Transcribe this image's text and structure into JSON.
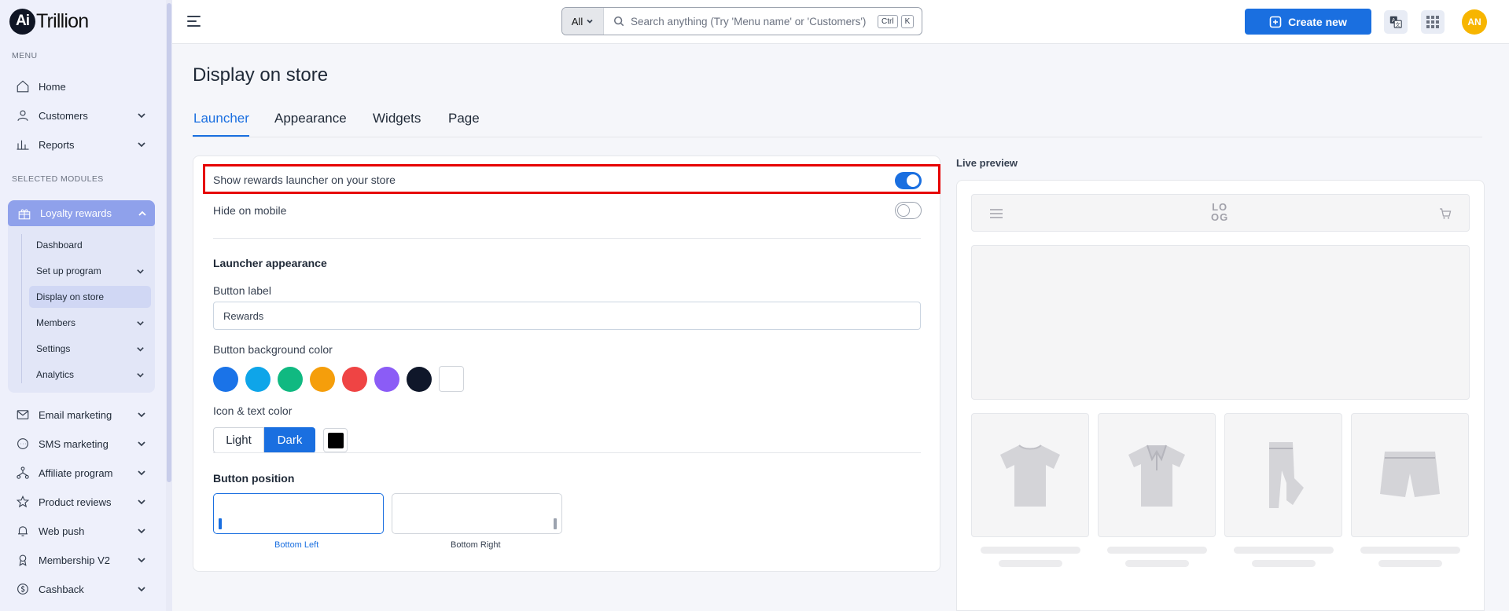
{
  "app": {
    "logo_mark": "Ai",
    "logo_text": "Trillion"
  },
  "sidebar": {
    "menu_label": "MENU",
    "menu_items": [
      {
        "label": "Home",
        "icon": "home-icon"
      },
      {
        "label": "Customers",
        "icon": "user-icon"
      },
      {
        "label": "Reports",
        "icon": "bar-chart-icon"
      }
    ],
    "modules_label": "SELECTED MODULES",
    "active_module": {
      "label": "Loyalty rewards",
      "icon": "gift-icon",
      "sub_items": [
        {
          "label": "Dashboard"
        },
        {
          "label": "Set up program"
        },
        {
          "label": "Display on store"
        },
        {
          "label": "Members"
        },
        {
          "label": "Settings"
        },
        {
          "label": "Analytics"
        }
      ]
    },
    "modules": [
      {
        "label": "Email marketing",
        "icon": "mail-icon"
      },
      {
        "label": "SMS marketing",
        "icon": "chat-icon"
      },
      {
        "label": "Affiliate program",
        "icon": "network-icon"
      },
      {
        "label": "Product reviews",
        "icon": "star-icon"
      },
      {
        "label": "Web push",
        "icon": "bell-icon"
      },
      {
        "label": "Membership V2",
        "icon": "badge-icon"
      },
      {
        "label": "Cashback",
        "icon": "coin-icon"
      }
    ]
  },
  "header": {
    "search_scope": "All",
    "search_placeholder": "Search anything (Try 'Menu name' or 'Customers')",
    "kbd_ctrl": "Ctrl",
    "kbd_k": "K",
    "create_label": "Create new",
    "avatar_initials": "AN"
  },
  "page": {
    "title": "Display on store",
    "tabs": [
      {
        "label": "Launcher"
      },
      {
        "label": "Appearance"
      },
      {
        "label": "Widgets"
      },
      {
        "label": "Page"
      }
    ],
    "show_launcher_label": "Show rewards launcher on your store",
    "hide_mobile_label": "Hide on mobile",
    "launcher_appearance_title": "Launcher appearance",
    "button_label_title": "Button label",
    "button_label_value": "Rewards",
    "bg_color_title": "Button background color",
    "bg_colors": [
      "#1a73e8",
      "#0ea5e9",
      "#10b981",
      "#f59e0b",
      "#ef4444",
      "#8b5cf6",
      "#0f172a"
    ],
    "icon_text_title": "Icon & text color",
    "light_label": "Light",
    "dark_label": "Dark",
    "position_title": "Button position",
    "pos_left": "Bottom Left",
    "pos_right": "Bottom Right"
  },
  "preview": {
    "title": "Live preview",
    "logo_top": "LO",
    "logo_bottom": "OG"
  },
  "colors": {
    "accent": "#1a6fe0",
    "highlight": "#e60000"
  }
}
